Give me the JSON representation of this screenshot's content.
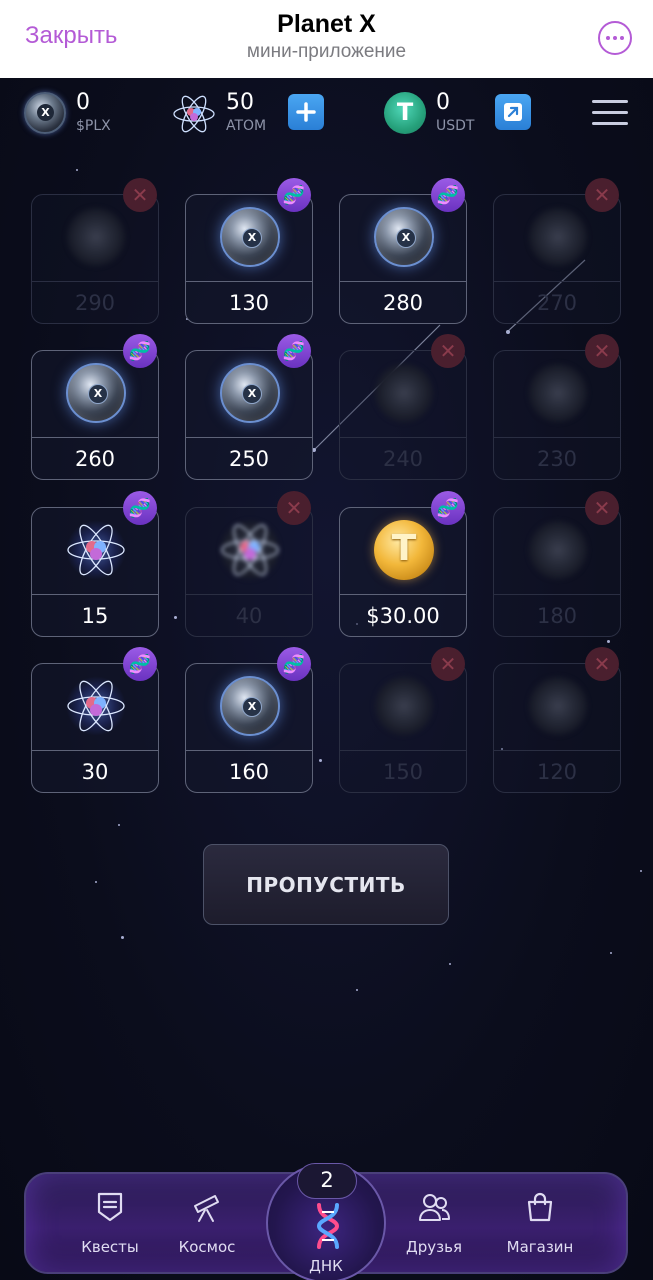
{
  "header": {
    "close_label": "Закрыть",
    "title": "Planet X",
    "subtitle": "мини-приложение",
    "more_icon": "more-horizontal-icon",
    "accent_color": "#b45bd6"
  },
  "balances": [
    {
      "value": "0",
      "label": "$PLX",
      "icon": "plx-coin-icon"
    },
    {
      "value": "50",
      "label": "ATOM",
      "icon": "atom-icon",
      "action_icon": "plus-icon"
    },
    {
      "value": "0",
      "label": "USDT",
      "icon": "usdt-coin-icon",
      "action_icon": "arrow-up-right-icon"
    }
  ],
  "grid": [
    {
      "value": "290",
      "type": "plx",
      "status": "faded"
    },
    {
      "value": "130",
      "type": "plx",
      "status": "active"
    },
    {
      "value": "280",
      "type": "plx",
      "status": "active"
    },
    {
      "value": "270",
      "type": "plx",
      "status": "faded"
    },
    {
      "value": "260",
      "type": "plx",
      "status": "active"
    },
    {
      "value": "250",
      "type": "plx",
      "status": "active"
    },
    {
      "value": "240",
      "type": "plx",
      "status": "faded"
    },
    {
      "value": "230",
      "type": "plx",
      "status": "faded"
    },
    {
      "value": "15",
      "type": "atom",
      "status": "active"
    },
    {
      "value": "40",
      "type": "atom",
      "status": "faded"
    },
    {
      "value": "$30.00",
      "type": "usdt",
      "status": "active"
    },
    {
      "value": "180",
      "type": "plx",
      "status": "faded"
    },
    {
      "value": "30",
      "type": "atom",
      "status": "active"
    },
    {
      "value": "160",
      "type": "plx",
      "status": "active"
    },
    {
      "value": "150",
      "type": "plx",
      "status": "faded"
    },
    {
      "value": "120",
      "type": "plx",
      "status": "faded"
    }
  ],
  "skip_button": "ПРОПУСТИТЬ",
  "bottom_nav": {
    "items": [
      {
        "label": "Квесты",
        "icon": "quests-icon"
      },
      {
        "label": "Космос",
        "icon": "telescope-icon"
      },
      {
        "label": "ДНК",
        "icon": "dna-icon",
        "count": "2"
      },
      {
        "label": "Друзья",
        "icon": "friends-icon"
      },
      {
        "label": "Магазин",
        "icon": "shop-bag-icon"
      }
    ]
  }
}
